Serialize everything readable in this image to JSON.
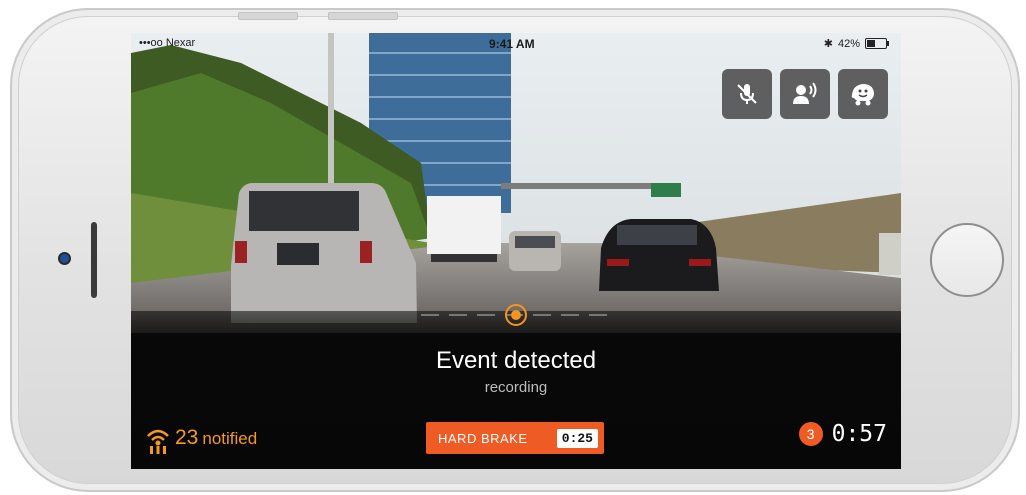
{
  "status_bar": {
    "carrier": "•••oo Nexar",
    "time": "9:41 AM",
    "battery_percent": "42%",
    "battery_level": 0.42
  },
  "controls": [
    {
      "name": "mute-mic-button",
      "icon": "microphone-off-icon"
    },
    {
      "name": "voice-command-button",
      "icon": "speaking-person-icon"
    },
    {
      "name": "waze-button",
      "icon": "waze-icon"
    }
  ],
  "event": {
    "title": "Event detected",
    "subtitle": "recording"
  },
  "notified": {
    "count": "23",
    "label": "notified",
    "icon": "broadcast-icon"
  },
  "hard_brake": {
    "label": "HARD BRAKE",
    "timer": "0:25"
  },
  "countdown": {
    "badge": "3",
    "time": "0:57"
  },
  "colors": {
    "accent": "#ef5b24",
    "notified": "#f39a1f",
    "marker": "#f7931e"
  }
}
